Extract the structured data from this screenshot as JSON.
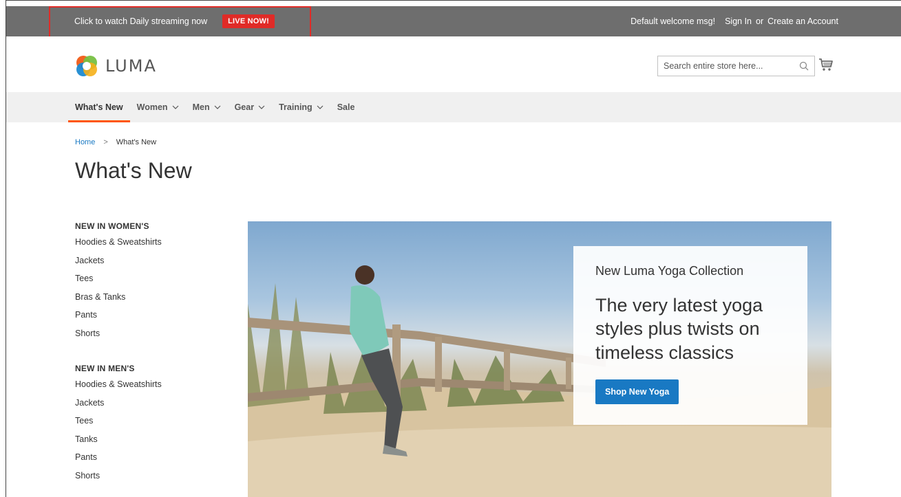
{
  "top_panel": {
    "promo_text": "Click to watch Daily streaming now",
    "live_badge": "LIVE NOW!",
    "welcome": "Default welcome msg!",
    "sign_in": "Sign In",
    "or": "or",
    "create_account": "Create an Account"
  },
  "header": {
    "logo_text": "LUMA",
    "search_placeholder": "Search entire store here...",
    "icons": {
      "search": "search-icon",
      "cart": "cart-icon"
    }
  },
  "nav": {
    "items": [
      {
        "label": "What's New",
        "dropdown": false,
        "active": true
      },
      {
        "label": "Women",
        "dropdown": true,
        "active": false
      },
      {
        "label": "Men",
        "dropdown": true,
        "active": false
      },
      {
        "label": "Gear",
        "dropdown": true,
        "active": false
      },
      {
        "label": "Training",
        "dropdown": true,
        "active": false
      },
      {
        "label": "Sale",
        "dropdown": false,
        "active": false
      }
    ]
  },
  "breadcrumb": {
    "home": "Home",
    "separator": ">",
    "current": "What's New"
  },
  "page_title": "What's New",
  "sidebar": {
    "groups": [
      {
        "title": "NEW IN WOMEN'S",
        "items": [
          "Hoodies & Sweatshirts",
          "Jackets",
          "Tees",
          "Bras & Tanks",
          "Pants",
          "Shorts"
        ]
      },
      {
        "title": "NEW IN MEN'S",
        "items": [
          "Hoodies & Sweatshirts",
          "Jackets",
          "Tees",
          "Tanks",
          "Pants",
          "Shorts"
        ]
      }
    ]
  },
  "hero": {
    "eyebrow": "New Luma Yoga Collection",
    "headline": "The very latest yoga styles plus twists on timeless classics",
    "cta": "Shop New Yoga"
  },
  "colors": {
    "top_bar": "#6e6e6e",
    "live_badge": "#e02b27",
    "nav_active_underline": "#ff5501",
    "link_blue": "#1979c3",
    "nav_bg": "#f0f0f0"
  }
}
